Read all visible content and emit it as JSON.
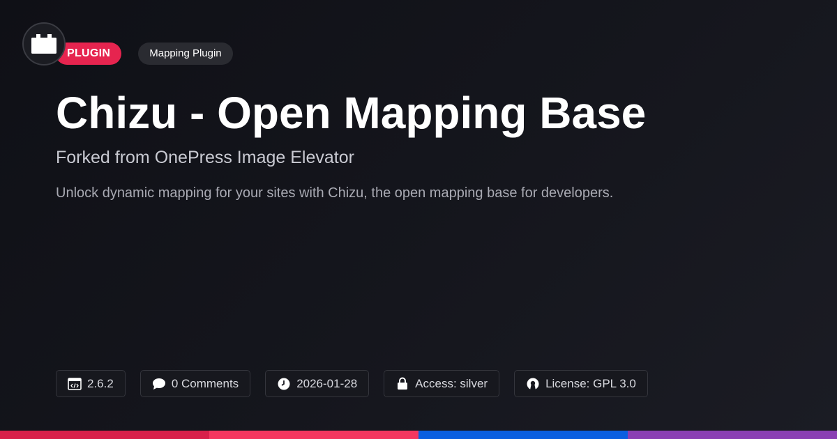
{
  "logo": {
    "icon": "plugin-block-icon"
  },
  "tags": {
    "type_label": "PLUGIN",
    "category_label": "Mapping Plugin"
  },
  "hero": {
    "title": "Chizu - Open Mapping Base",
    "subtitle": "Forked from OnePress Image Elevator",
    "description": "Unlock dynamic mapping for your sites with Chizu, the open mapping base for developers."
  },
  "meta": {
    "version": "2.6.2",
    "comments": "0 Comments",
    "date": "2026-01-28",
    "access": "Access: silver",
    "license": "License: GPL 3.0"
  },
  "colors": {
    "accent": "#e6244f",
    "bar": [
      "#d8204a",
      "#f4375f",
      "#0a5fe0",
      "#8a3fb3"
    ]
  }
}
